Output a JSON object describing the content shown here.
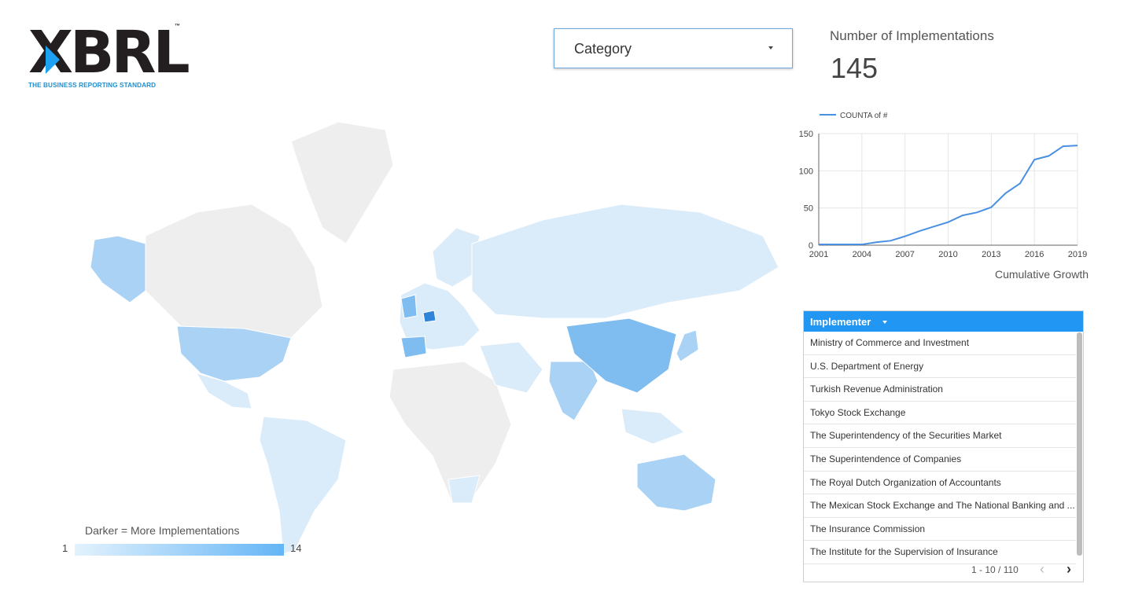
{
  "logo": {
    "word": "XBRL",
    "tm": "™",
    "tagline": "THE BUSINESS REPORTING STANDARD"
  },
  "filter": {
    "label": "Category",
    "icon": "caret-down-icon"
  },
  "kpi": {
    "title": "Number of Implementations",
    "value": "145"
  },
  "chart_data": {
    "type": "line",
    "series": [
      {
        "name": "COUNTA of #",
        "x": [
          2001,
          2002,
          2003,
          2004,
          2005,
          2006,
          2007,
          2008,
          2009,
          2010,
          2011,
          2012,
          2013,
          2014,
          2015,
          2016,
          2017,
          2018,
          2019
        ],
        "values": [
          1,
          1,
          1,
          1,
          4,
          6,
          12,
          19,
          25,
          31,
          40,
          44,
          51,
          70,
          83,
          115,
          120,
          133,
          134
        ]
      }
    ],
    "xticks": [
      "2001",
      "2004",
      "2007",
      "2010",
      "2013",
      "2016",
      "2019"
    ],
    "yticks": [
      "0",
      "50",
      "100",
      "150"
    ],
    "xlim": [
      2001,
      2019
    ],
    "ylim": [
      0,
      150
    ],
    "xlabel": "Cumulative Growth",
    "ylabel": "",
    "grid": true,
    "legend": "top-left",
    "color": "#4a90e2"
  },
  "map": {
    "legend_title": "Darker = More Implementations",
    "legend_min": "1",
    "legend_max": "14",
    "color_low": "#e3f2fd",
    "color_high": "#64b5f6",
    "base_color": "#eeeeee"
  },
  "table": {
    "header": "Implementer",
    "rows": [
      "Ministry of Commerce and Investment",
      "U.S. Department of Energy",
      "Turkish Revenue Administration",
      "Tokyo Stock Exchange",
      "The Superintendency of the Securities Market",
      "The Superintendence of Companies",
      "The Royal Dutch Organization of Accountants",
      "The Mexican Stock Exchange and The National Banking and ...",
      "The Insurance Commission",
      "The Institute for the Supervision of Insurance"
    ],
    "pagination": "1 - 10 / 110",
    "prev": "‹",
    "next": "›"
  }
}
